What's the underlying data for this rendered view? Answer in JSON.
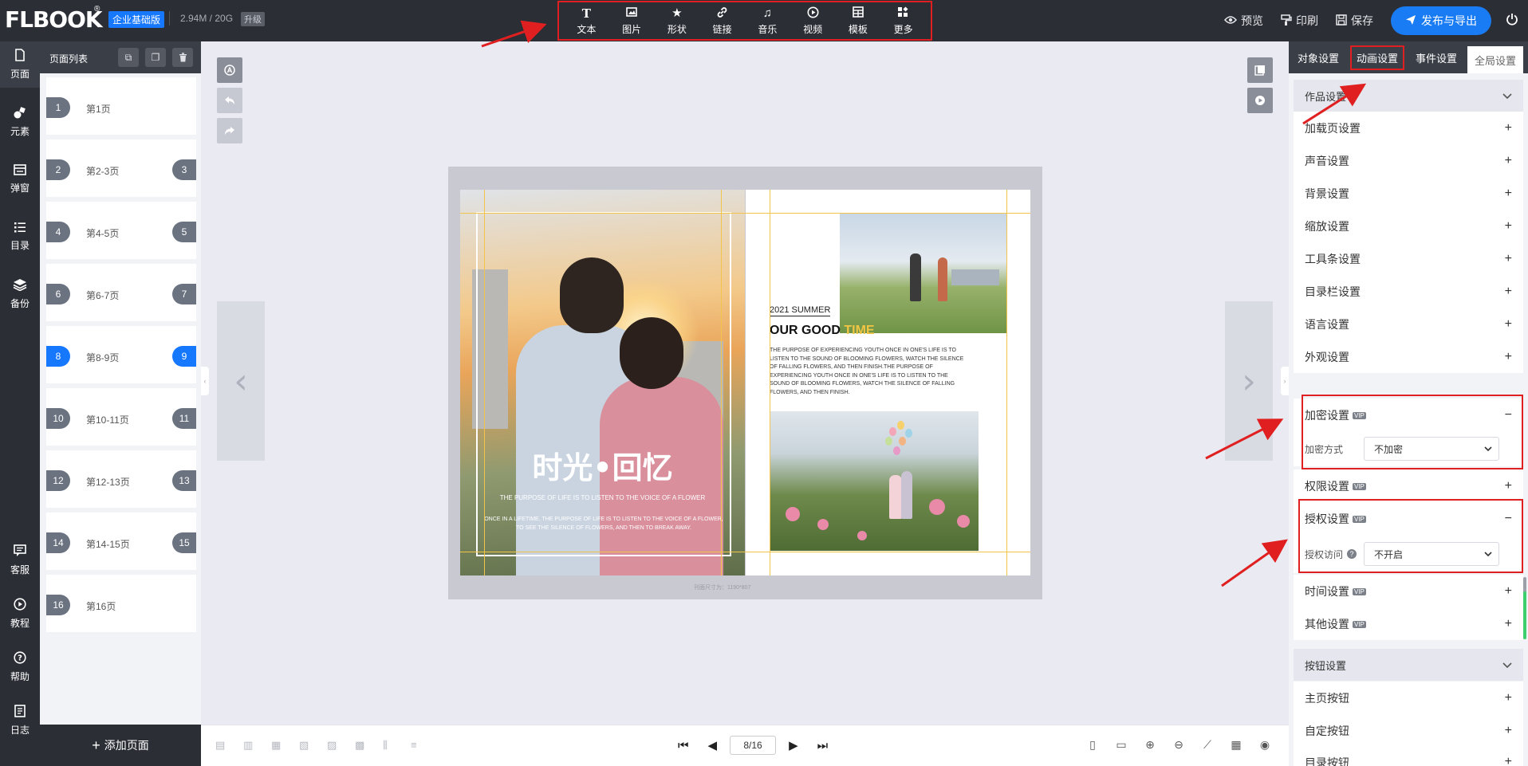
{
  "header": {
    "logo": "FLBOOK",
    "logo_mark": "®",
    "edition": "企业基础版",
    "storage": "2.94M / 20G",
    "upgrade": "升级"
  },
  "toolbar": [
    {
      "label": "文本",
      "icon": "text-icon"
    },
    {
      "label": "图片",
      "icon": "image-icon"
    },
    {
      "label": "形状",
      "icon": "star-icon"
    },
    {
      "label": "链接",
      "icon": "link-icon"
    },
    {
      "label": "音乐",
      "icon": "music-icon"
    },
    {
      "label": "视频",
      "icon": "video-icon"
    },
    {
      "label": "模板",
      "icon": "template-icon"
    },
    {
      "label": "更多",
      "icon": "more-icon"
    }
  ],
  "top_actions": {
    "preview": "预览",
    "print": "印刷",
    "save": "保存",
    "publish": "发布与导出"
  },
  "left_nav": [
    {
      "label": "页面",
      "icon": "page-icon"
    },
    {
      "label": "元素",
      "icon": "elements-icon"
    },
    {
      "label": "弹窗",
      "icon": "popup-icon"
    },
    {
      "label": "目录",
      "icon": "toc-icon"
    },
    {
      "label": "备份",
      "icon": "backup-icon"
    },
    {
      "label": "客服",
      "icon": "chat-icon"
    },
    {
      "label": "教程",
      "icon": "play-icon"
    },
    {
      "label": "帮助",
      "icon": "help-icon"
    },
    {
      "label": "日志",
      "icon": "log-icon"
    }
  ],
  "page_panel": {
    "title": "页面列表",
    "add_page": "添加页面",
    "pages": [
      {
        "num": "1",
        "label": "第1页",
        "num2": ""
      },
      {
        "num": "2",
        "label": "第2-3页",
        "num2": "3"
      },
      {
        "num": "4",
        "label": "第4-5页",
        "num2": "5"
      },
      {
        "num": "6",
        "label": "第6-7页",
        "num2": "7"
      },
      {
        "num": "8",
        "label": "第8-9页",
        "num2": "9",
        "active": true
      },
      {
        "num": "10",
        "label": "第10-11页",
        "num2": "11"
      },
      {
        "num": "12",
        "label": "第12-13页",
        "num2": "13"
      },
      {
        "num": "14",
        "label": "第14-15页",
        "num2": "15"
      },
      {
        "num": "16",
        "label": "第16页",
        "num2": ""
      }
    ]
  },
  "book": {
    "left_title": "时光•回忆",
    "left_line1": "THE PURPOSE OF LIFE IS TO LISTEN TO THE VOICE OF A FLOWER",
    "left_line2": "ONCE IN A LIFETIME, THE PURPOSE OF LIFE IS TO LISTEN TO THE VOICE OF A FLOWER, TO SEE THE SILENCE OF FLOWERS, AND THEN TO BREAK AWAY.",
    "summer_tag": "2021 SUMMER",
    "good_time_main": "OUR GOOD ",
    "good_time_accent": "TIME",
    "paragraph": "THE PURPOSE OF EXPERIENCING YOUTH ONCE IN ONE'S LIFE IS TO LISTEN TO THE SOUND OF BLOOMING FLOWERS, WATCH THE SILENCE OF FALLING FLOWERS, AND THEN FINISH.THE PURPOSE OF EXPERIENCING YOUTH ONCE IN ONE'S LIFE IS TO LISTEN TO THE SOUND OF BLOOMING FLOWERS, WATCH THE SILENCE OF FALLING FLOWERS, AND THEN FINISH.",
    "size_note": "刊面尺寸为：1190*807"
  },
  "pager": {
    "current": "8/16"
  },
  "right_panel": {
    "tabs": [
      "对象设置",
      "动画设置",
      "事件设置",
      "全局设置"
    ],
    "active_tab": "全局设置",
    "works_section": "作品设置",
    "rows": [
      {
        "label": "加载页设置",
        "vip": false,
        "sign": "+"
      },
      {
        "label": "声音设置",
        "vip": false,
        "sign": "+"
      },
      {
        "label": "背景设置",
        "vip": false,
        "sign": "+"
      },
      {
        "label": "缩放设置",
        "vip": false,
        "sign": "+"
      },
      {
        "label": "工具条设置",
        "vip": false,
        "sign": "+"
      },
      {
        "label": "目录栏设置",
        "vip": false,
        "sign": "+"
      },
      {
        "label": "语言设置",
        "vip": false,
        "sign": "+"
      },
      {
        "label": "外观设置",
        "vip": false,
        "sign": "+"
      }
    ],
    "encrypt": {
      "label": "加密设置",
      "vip": "VIP",
      "sign": "−",
      "field_label": "加密方式",
      "value": "不加密"
    },
    "permission": {
      "label": "权限设置",
      "vip": "VIP",
      "sign": "+"
    },
    "auth": {
      "label": "授权设置",
      "vip": "VIP",
      "sign": "−",
      "field_label": "授权访问",
      "value": "不开启"
    },
    "time": {
      "label": "时间设置",
      "vip": "VIP",
      "sign": "+"
    },
    "other": {
      "label": "其他设置",
      "vip": "VIP",
      "sign": "+"
    },
    "button_section": "按钮设置",
    "button_rows": [
      {
        "label": "主页按钮",
        "sign": "+"
      },
      {
        "label": "自定按钮",
        "sign": "+"
      },
      {
        "label": "目录按钮",
        "sign": "+"
      }
    ]
  },
  "colors": {
    "topbar": "#2b2e35",
    "accent": "#1677ff",
    "highlight": "#e02020"
  }
}
